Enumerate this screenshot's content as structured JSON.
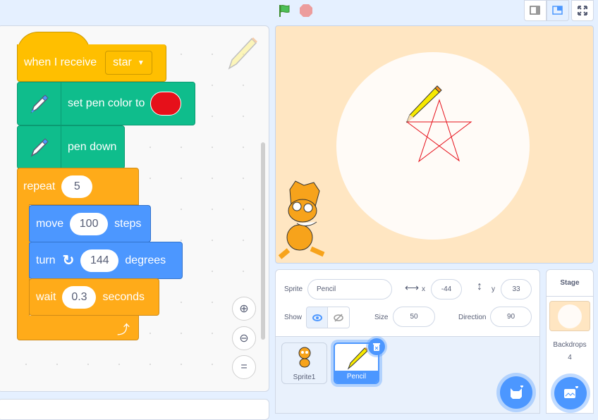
{
  "topbar": {
    "green_flag": "green-flag",
    "stop": "stop",
    "layout_small": "small-stage",
    "layout_normal": "normal-stage",
    "fullscreen": "fullscreen"
  },
  "code": {
    "hat": {
      "label": "when I receive",
      "message": "star"
    },
    "set_pen_color": {
      "label": "set pen color to",
      "color": "#e6101a"
    },
    "pen_down": {
      "label": "pen down"
    },
    "repeat": {
      "label": "repeat",
      "times": "5"
    },
    "move": {
      "label": "move",
      "steps": "100",
      "suffix": "steps"
    },
    "turn": {
      "label": "turn",
      "degrees": "144",
      "suffix": "degrees"
    },
    "wait": {
      "label": "wait",
      "seconds": "0.3",
      "suffix": "seconds"
    }
  },
  "sprite_info": {
    "sprite_label": "Sprite",
    "sprite_name": "Pencil",
    "x_label": "x",
    "x": "-44",
    "y_label": "y",
    "y": "33",
    "show_label": "Show",
    "size_label": "Size",
    "size": "50",
    "direction_label": "Direction",
    "direction": "90"
  },
  "sprites": [
    {
      "name": "Sprite1",
      "selected": false
    },
    {
      "name": "Pencil",
      "selected": true
    }
  ],
  "stage_panel": {
    "title": "Stage",
    "backdrops_label": "Backdrops",
    "backdrops_count": "4"
  },
  "colors": {
    "accent": "#4c97ff",
    "pen_red": "#e6101a"
  }
}
